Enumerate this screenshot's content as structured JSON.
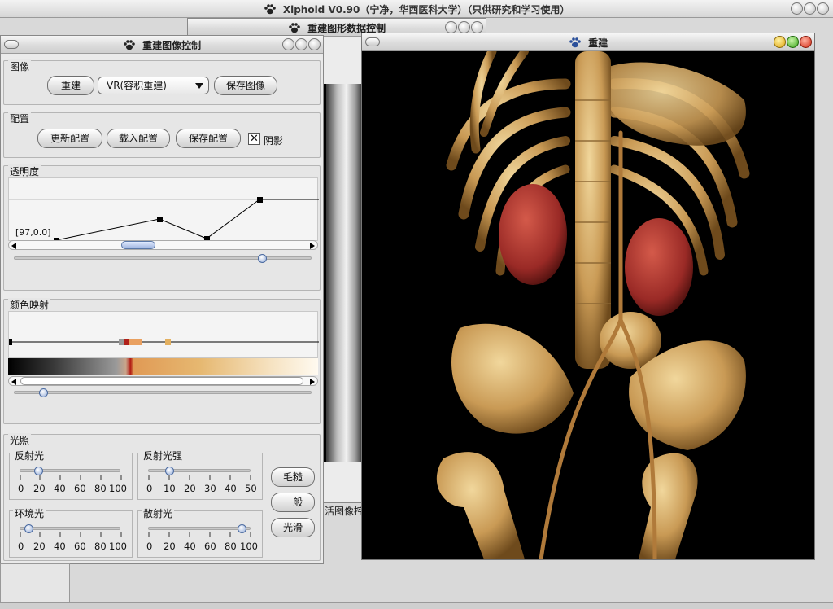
{
  "app_title": "Xiphoid V0.90（宁净，华西医科大学）（只供研究和学习使用）",
  "data_window": {
    "title": "重建图形数据控制",
    "partial_label": "活图像控"
  },
  "control_window": {
    "title": "重建图像控制",
    "image_group": {
      "title": "图像",
      "rebuild_button": "重建",
      "mode_select": "VR(容积重建)",
      "save_image_button": "保存图像"
    },
    "config_group": {
      "title": "配置",
      "update_button": "更新配置",
      "load_button": "载入配置",
      "save_button": "保存配置",
      "shadow_label": "阴影",
      "shadow_checked": "✕"
    },
    "opacity_group": {
      "title": "透明度",
      "point_readout": "[97,0.0]"
    },
    "colormap_group": {
      "title": "颜色映射"
    },
    "lighting_group": {
      "title": "光照",
      "reflect": {
        "label": "反射光",
        "ticks": [
          "0",
          "20",
          "40",
          "60",
          "80",
          "100"
        ],
        "value": 10
      },
      "reflect_strength": {
        "label": "反射光强",
        "ticks": [
          "0",
          "10",
          "20",
          "30",
          "40",
          "50"
        ],
        "value": 10
      },
      "ambient": {
        "label": "环境光",
        "ticks": [
          "0",
          "20",
          "40",
          "60",
          "80",
          "100"
        ],
        "value": 5
      },
      "diffuse": {
        "label": "散射光",
        "ticks": [
          "0",
          "20",
          "40",
          "60",
          "80",
          "100"
        ],
        "value": 93
      },
      "rough_button": "毛糙",
      "normal_button": "一般",
      "smooth_button": "光滑"
    }
  },
  "render_window": {
    "title": "重建"
  },
  "colors": {
    "accent": "#6a8cc7",
    "bone": "#d9b57a",
    "kidney": "#a8322d"
  }
}
